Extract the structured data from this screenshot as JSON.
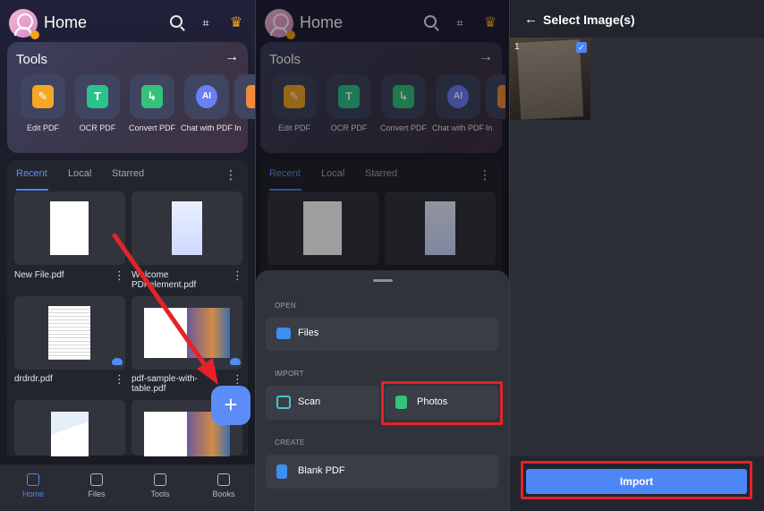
{
  "home": {
    "title": "Home",
    "tools_title": "Tools",
    "tools": [
      {
        "label": "Edit PDF",
        "icon": "edit-pdf-icon",
        "color": "#f5a623"
      },
      {
        "label": "OCR PDF",
        "icon": "ocr-pdf-icon",
        "color": "#2cc38a"
      },
      {
        "label": "Convert PDF",
        "icon": "convert-pdf-icon",
        "color": "#35c27b"
      },
      {
        "label": "Chat with PDF",
        "icon": "ai-chat-icon",
        "color": "#6b7ff5"
      },
      {
        "label": "In",
        "icon": "more-tool-icon",
        "color": "#f08a3a"
      }
    ],
    "tabs": [
      "Recent",
      "Local",
      "Starred"
    ],
    "files": [
      {
        "name": "New File.pdf"
      },
      {
        "name": "Welcome PDFelement.pdf"
      },
      {
        "name": "drdrdr.pdf"
      },
      {
        "name": "pdf-sample-with-table.pdf"
      }
    ],
    "nav": [
      "Home",
      "Files",
      "Tools",
      "Books"
    ],
    "fab": "+"
  },
  "sheet": {
    "open_label": "OPEN",
    "files_label": "Files",
    "import_label": "IMPORT",
    "scan_label": "Scan",
    "photos_label": "Photos",
    "create_label": "CREATE",
    "blank_label": "Blank PDF"
  },
  "picker": {
    "title": "Select Image(s)",
    "image_index": "1",
    "import_label": "Import"
  },
  "colors": {
    "accent": "#4d86f7",
    "highlight": "#e5222b"
  }
}
